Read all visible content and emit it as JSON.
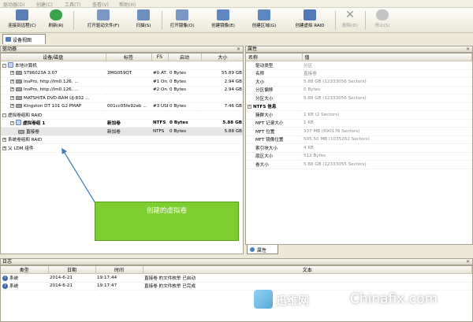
{
  "menu": [
    "驱动器(D)",
    "创建(C)",
    "工具(T)",
    "查看(V)",
    "帮助(H)"
  ],
  "toolbar": {
    "buttons": [
      {
        "label": "连接到远程(C)",
        "icon": "remote-connect-icon",
        "color": "#5a7fb5"
      },
      {
        "label": "刷新(R)",
        "icon": "refresh-icon",
        "color": "#3aa34a"
      },
      {
        "label": "打开驱动文件(F)",
        "icon": "open-drive-file-icon",
        "color": "#7d97c4"
      },
      {
        "label": "扫描(S)",
        "icon": "scan-icon",
        "color": "#6f8fbf"
      },
      {
        "label": "打开镜像(O)",
        "icon": "open-image-icon",
        "color": "#7d97c4"
      },
      {
        "label": "创建镜像(E)",
        "icon": "create-image-icon",
        "color": "#5d86c2"
      },
      {
        "label": "创建区域(G)",
        "icon": "create-region-icon",
        "color": "#5d86c2"
      },
      {
        "label": "创建虚拟 RAID",
        "icon": "create-virtual-raid-icon",
        "color": "#4f79b8"
      },
      {
        "label": "删除(D)",
        "icon": "delete-icon",
        "color": "#b5b5b5"
      },
      {
        "label": "停止(S)",
        "icon": "stop-icon",
        "color": "#b5b5b5"
      }
    ]
  },
  "tab_device_view": "设备视图",
  "drives_panel": {
    "title": "驱动器",
    "columns": [
      "设备/磁盘",
      "标签",
      "FS",
      "启动",
      "大小"
    ],
    "rows": [
      {
        "name": "本地计算机",
        "label": "",
        "fs": "",
        "start": "",
        "size": "",
        "level": 0,
        "type": "group",
        "bold": false,
        "expander": "-"
      },
      {
        "name": "ST96023A 3.07",
        "label": "3MG059QT",
        "fs": "#0 AT...",
        "start": "0 Bytes",
        "size": "55.89 GB",
        "level": 1,
        "type": "dev",
        "bold": false,
        "expander": "+"
      },
      {
        "name": "InsPro, http://lm0.126. ...",
        "label": "",
        "fs": "#1 On...",
        "start": "0 Bytes",
        "size": "2.94 GB",
        "level": 1,
        "type": "dev",
        "bold": false,
        "expander": "+"
      },
      {
        "name": "InsPro, http://lm0.126. ...",
        "label": "",
        "fs": "#2 On...",
        "start": "0 Bytes",
        "size": "2.94 GB",
        "level": 1,
        "type": "dev",
        "bold": false,
        "expander": "+"
      },
      {
        "name": "MATSHITA DVD-RAM UJ-832 ...",
        "label": "",
        "fs": "",
        "start": "",
        "size": "",
        "level": 1,
        "type": "dev",
        "bold": false,
        "expander": "+"
      },
      {
        "name": "Kingston DT 101 G2 PMAP",
        "label": "001cc05fe92eb ...",
        "fs": "#3 USB",
        "start": "0 Bytes",
        "size": "7.46 GB",
        "level": 1,
        "type": "dev",
        "bold": false,
        "expander": "+"
      },
      {
        "name": "虚拟卷组和 RAID",
        "label": "",
        "fs": "",
        "start": "",
        "size": "",
        "level": 0,
        "type": "none",
        "bold": false,
        "expander": "-"
      },
      {
        "name": "虚拟卷组 1",
        "label": "新加卷",
        "fs": "NTFS",
        "start": "0 Bytes",
        "size": "5.88 GB",
        "level": 1,
        "type": "group",
        "bold": true,
        "expander": "-"
      },
      {
        "name": "直接卷",
        "label": "新加卷",
        "fs": "NTFS",
        "start": "0 Bytes",
        "size": "5.88 GB",
        "level": 2,
        "type": "dev",
        "bold": false,
        "expander": "",
        "selected": true
      },
      {
        "name": "系统卷组和 RAID",
        "label": "",
        "fs": "",
        "start": "",
        "size": "",
        "level": 0,
        "type": "none",
        "bold": false,
        "expander": "+"
      },
      {
        "name": "父 LDM 组件",
        "label": "",
        "fs": "",
        "start": "",
        "size": "",
        "level": 0,
        "type": "none",
        "bold": false,
        "expander": "+"
      }
    ]
  },
  "props_panel": {
    "title": "属性",
    "columns": [
      "名称",
      "值"
    ],
    "rows": [
      {
        "k": "驱动类型",
        "v": "分区"
      },
      {
        "k": "名称",
        "v": "直接卷"
      },
      {
        "k": "大小",
        "v": "5.88 GB (12333056 Sectors)"
      },
      {
        "k": "分区偏移",
        "v": "0 Bytes"
      },
      {
        "k": "分区大小",
        "v": "5.88 GB (12333056 Sectors)"
      },
      {
        "section": "NTFS 信息"
      },
      {
        "k": "簇群大小",
        "v": "1 KB (2 Sectors)"
      },
      {
        "k": "MFT 记录大小",
        "v": "1 KB"
      },
      {
        "k": "MFT 位置",
        "v": "337 MB (690176 Sectors)"
      },
      {
        "k": "MFT 镜像位置",
        "v": "505.50 MB (1035262 Sectors)"
      },
      {
        "k": "索引块大小",
        "v": "4 KB"
      },
      {
        "k": "扇区大小",
        "v": "512 Bytes"
      },
      {
        "k": "卷大小",
        "v": "5.88 GB (12333055 Sectors)"
      }
    ],
    "tab_label": "属性"
  },
  "log_panel": {
    "title": "日志",
    "columns": [
      "类型",
      "日期",
      "时间",
      "文本"
    ],
    "rows": [
      {
        "type": "系统",
        "date": "2014-6-21",
        "time": "19:17:44",
        "text": "直接卷 的文件枚举 已启动"
      },
      {
        "type": "系统",
        "date": "2014-6-21",
        "time": "19:17:47",
        "text": "直接卷 的文件枚举 已完成"
      }
    ]
  },
  "callout_text": "创建的虚拟卷",
  "watermark": {
    "cn": "迅维网",
    "en": "Chinafix.com"
  }
}
